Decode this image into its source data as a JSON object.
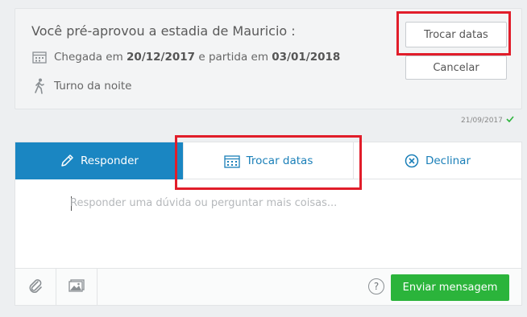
{
  "reservation": {
    "title": "Você pré-aprovou a estadia de Mauricio :",
    "arrival_prefix": "Chegada em",
    "arrival_date": "20/12/2017",
    "departure_prefix": "e partida em",
    "departure_date": "03/01/2018",
    "shift": "Turno da noite",
    "change_dates_label": "Trocar datas",
    "cancel_label": "Cancelar",
    "timestamp": "21/09/2017"
  },
  "composer": {
    "tabs": [
      {
        "label": "Responder",
        "icon": "pencil-icon",
        "active": true
      },
      {
        "label": "Trocar datas",
        "icon": "calendar-icon",
        "active": false
      },
      {
        "label": "Declinar",
        "icon": "x-circle-icon",
        "active": false
      }
    ],
    "placeholder": "Responder uma dúvida ou perguntar mais coisas...",
    "help_label": "?",
    "send_label": "Enviar mensagem"
  },
  "colors": {
    "accent": "#1a86c2",
    "send_green": "#2bb43b",
    "highlight_red": "#e11d2a"
  }
}
